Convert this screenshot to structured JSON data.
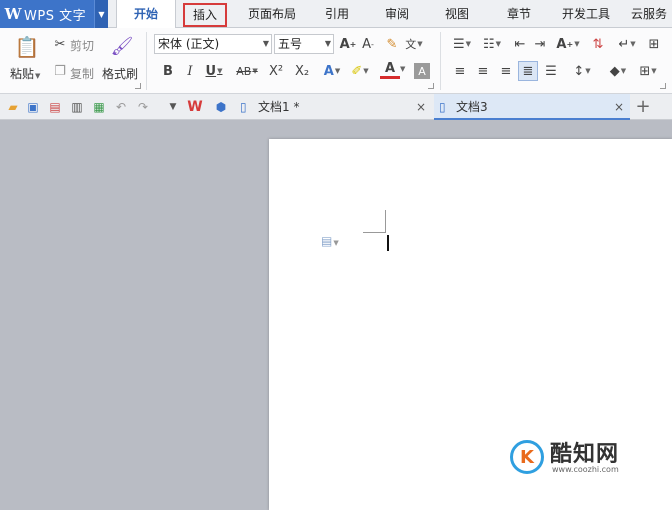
{
  "app": {
    "title": "WPS 文字",
    "logo_letter": "W"
  },
  "menu_tabs": [
    {
      "label": "开始",
      "active": true
    },
    {
      "label": "插入",
      "highlighted": true
    },
    {
      "label": "页面布局"
    },
    {
      "label": "引用"
    },
    {
      "label": "审阅"
    },
    {
      "label": "视图"
    },
    {
      "label": "章节"
    },
    {
      "label": "开发工具"
    },
    {
      "label": "云服务"
    }
  ],
  "ribbon": {
    "paste_label": "粘贴",
    "cut_label": "剪切",
    "copy_label": "复制",
    "format_painter_label": "格式刷",
    "font_name": "宋体 (正文)",
    "font_size": "五号",
    "bold": "B",
    "italic": "I",
    "underline": "U",
    "strike": "AB",
    "superscript": "X²",
    "subscript": "X₂"
  },
  "doc_tabs": [
    {
      "label": "文档1 *",
      "active": false
    },
    {
      "label": "文档3",
      "active": true
    }
  ],
  "new_tab": "+",
  "close_glyph": "×",
  "watermark": {
    "title": "酷知网",
    "url": "www.coozhi.com",
    "logo_letter": "K"
  },
  "colors": {
    "accent": "#3d74c9",
    "highlight_border": "#d63b3b"
  }
}
